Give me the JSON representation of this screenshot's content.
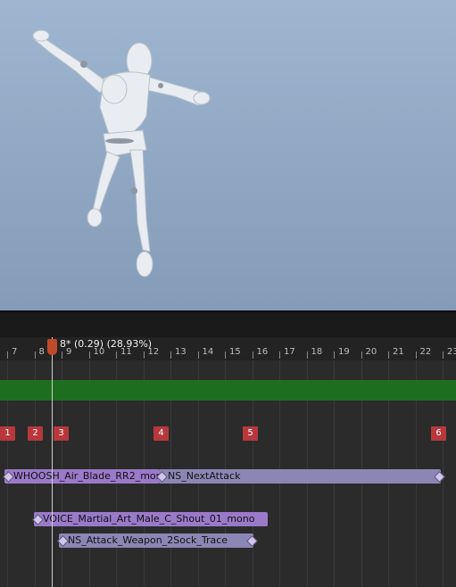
{
  "timeline": {
    "frame_readout": "8* (0.29) (28.93%)",
    "ruler_labels": [
      "7",
      "8",
      "9",
      "10",
      "11",
      "12",
      "13",
      "14",
      "15",
      "16",
      "17",
      "18",
      "19",
      "20",
      "21",
      "22",
      "23"
    ],
    "markers": [
      "1",
      "2",
      "3",
      "4",
      "5",
      "6"
    ],
    "notifies": {
      "whoosh": "WHOOSH_Air_Blade_RR2_mono",
      "next_attack": "NS_NextAttack",
      "voice": "VOICE_Martial_Art_Male_C_Shout_01_mono",
      "trace": "NS_Attack_Weapon_2Sock_Trace"
    }
  },
  "colors": {
    "marker": "#b7383c",
    "green_track": "#1d6f1f",
    "notify_purple": "#9b79c9",
    "notify_lavender": "#8c86b5",
    "playhead": "#c14a2c"
  }
}
